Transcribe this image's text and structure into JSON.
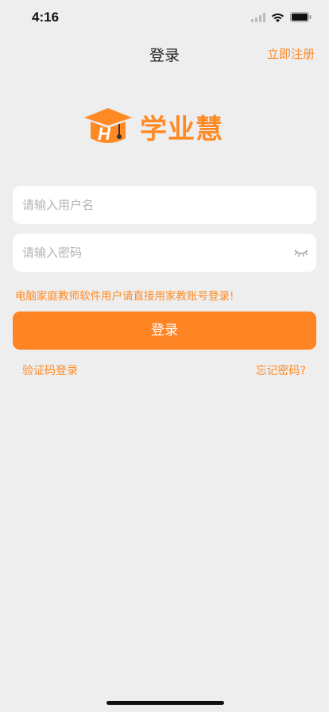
{
  "status_bar": {
    "time": "4:16"
  },
  "nav": {
    "title": "登录",
    "register_label": "立即注册"
  },
  "logo": {
    "text": "学业慧"
  },
  "form": {
    "username_placeholder": "请输入用户名",
    "password_placeholder": "请输入密码",
    "hint": "电脑家庭教师软件用户请直接用家教账号登录!",
    "login_label": "登录",
    "sms_login_label": "验证码登录",
    "forgot_label": "忘记密码?"
  },
  "colors": {
    "accent": "#ff8a24",
    "background": "#eeeeee"
  }
}
